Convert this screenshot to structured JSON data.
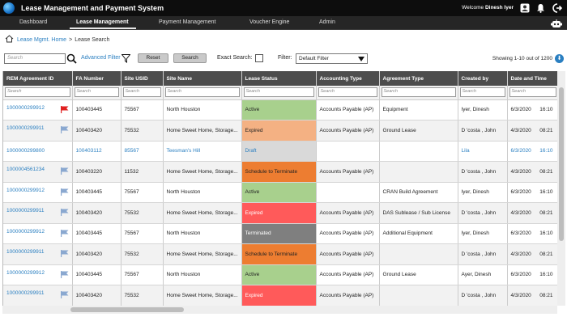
{
  "app": {
    "title": "Lease Management and Payment System"
  },
  "user": {
    "welcome": "Welcome",
    "name": "Dinesh Iyer"
  },
  "nav": {
    "items": [
      {
        "label": "Dashboard"
      },
      {
        "label": "Lease Management"
      },
      {
        "label": "Payment Management"
      },
      {
        "label": "Voucher Engine"
      },
      {
        "label": "Admin"
      }
    ]
  },
  "breadcrumb": {
    "home": "Lease Mgmt. Home",
    "sep": ">",
    "current": "Lease Search"
  },
  "toolbar": {
    "search_placeholder": "Search",
    "advanced_filter": "Advanced Filter",
    "reset": "Reset",
    "search": "Search",
    "exact_search": "Exact Search:",
    "filter_label": "Filter:",
    "filter_value": "Default Filter",
    "showing": "Showing 1-10 out of 1200"
  },
  "colors": {
    "active": "#a8d08d",
    "expired_light": "#f4b183",
    "draft": "#d9d9d9",
    "schedule": "#ed7d31",
    "expired": "#ff5a5a",
    "terminated": "#7f7f7f",
    "flag_red": "#e02020",
    "flag_blue": "#8aa8d0"
  },
  "table": {
    "columns": [
      "REM Agreement ID",
      "FA Number",
      "Site USID",
      "Site Name",
      "Lease Status",
      "Accounting Type",
      "Agreement Type",
      "Created by",
      "Date and Time"
    ],
    "filter_placeholder": "Search",
    "rows": [
      {
        "id": "1000000299912",
        "flag": "red",
        "fa": "100403445",
        "usid": "75567",
        "site": "North Houston",
        "status": "Active",
        "status_kind": "active",
        "acct": "Accounts Payable (AP)",
        "agree": "Equipment",
        "by": "Iyer, Dinesh",
        "date": "6/3/2020",
        "time": "16:10"
      },
      {
        "id": "1000000299911",
        "flag": "blue",
        "fa": "100403420",
        "usid": "75532",
        "site": "Home Sweet Home, Storage...",
        "status": "Expired",
        "status_kind": "expired_light",
        "acct": "Accounts Payable (AP)",
        "agree": "Ground Lease",
        "by": "D 'costa , John",
        "date": "4/3/2020",
        "time": "08:21"
      },
      {
        "id": "1000000299800",
        "flag": "",
        "fa": "100403112",
        "usid": "85567",
        "site": "Teesman's Hill",
        "status": "Draft",
        "status_kind": "draft",
        "acct": "",
        "agree": "",
        "by": "Lila",
        "date": "6/3/2020",
        "time": "16:10",
        "draft": true
      },
      {
        "id": "1000004561234",
        "flag": "blue",
        "fa": "100403220",
        "usid": "11532",
        "site": "Home Sweet Home, Storage...",
        "status": "Schedule to Terminate",
        "status_kind": "schedule",
        "acct": "Accounts Payable (AP)",
        "agree": "",
        "by": "D 'costa , John",
        "date": "4/3/2020",
        "time": "08:21"
      },
      {
        "id": "1000000299912",
        "flag": "blue",
        "fa": "100403445",
        "usid": "75567",
        "site": "North Houston",
        "status": "Active",
        "status_kind": "active",
        "acct": "",
        "agree": "CRAN Build Agreement",
        "by": "Iyer, Dinesh",
        "date": "6/3/2020",
        "time": "16:10"
      },
      {
        "id": "1000000299911",
        "flag": "blue",
        "fa": "100403420",
        "usid": "75532",
        "site": "Home Sweet Home, Storage...",
        "status": "Expired",
        "status_kind": "expired",
        "acct": "Accounts Payable (AP)",
        "agree": "DAS Sublease / Sub License",
        "by": "D 'costa , John",
        "date": "4/3/2020",
        "time": "08:21"
      },
      {
        "id": "1000000299912",
        "flag": "blue",
        "fa": "100403445",
        "usid": "75567",
        "site": "North Houston",
        "status": "Terminated",
        "status_kind": "terminated",
        "acct": "Accounts Payable (AP)",
        "agree": "Additional Equipment",
        "by": "Iyer, Dinesh",
        "date": "6/3/2020",
        "time": "16:10"
      },
      {
        "id": "1000000299911",
        "flag": "blue",
        "fa": "100403420",
        "usid": "75532",
        "site": "Home Sweet Home, Storage...",
        "status": "Schedule to Terminate",
        "status_kind": "schedule",
        "acct": "Accounts Payable (AP)",
        "agree": "",
        "by": "D 'costa , John",
        "date": "4/3/2020",
        "time": "08:21"
      },
      {
        "id": "1000000299912",
        "flag": "blue",
        "fa": "100403445",
        "usid": "75567",
        "site": "North Houston",
        "status": "Active",
        "status_kind": "active",
        "acct": "Accounts Payable (AP)",
        "agree": "Ground Lease",
        "by": "Ayer, Dinesh",
        "date": "6/3/2020",
        "time": "16:10"
      },
      {
        "id": "1000000299911",
        "flag": "blue",
        "fa": "100403420",
        "usid": "75532",
        "site": "Home Sweet Home, Storage...",
        "status": "Expired",
        "status_kind": "expired",
        "acct": "Accounts Payable (AP)",
        "agree": "",
        "by": "D 'costa , John",
        "date": "4/3/2020",
        "time": "08:21"
      }
    ]
  }
}
